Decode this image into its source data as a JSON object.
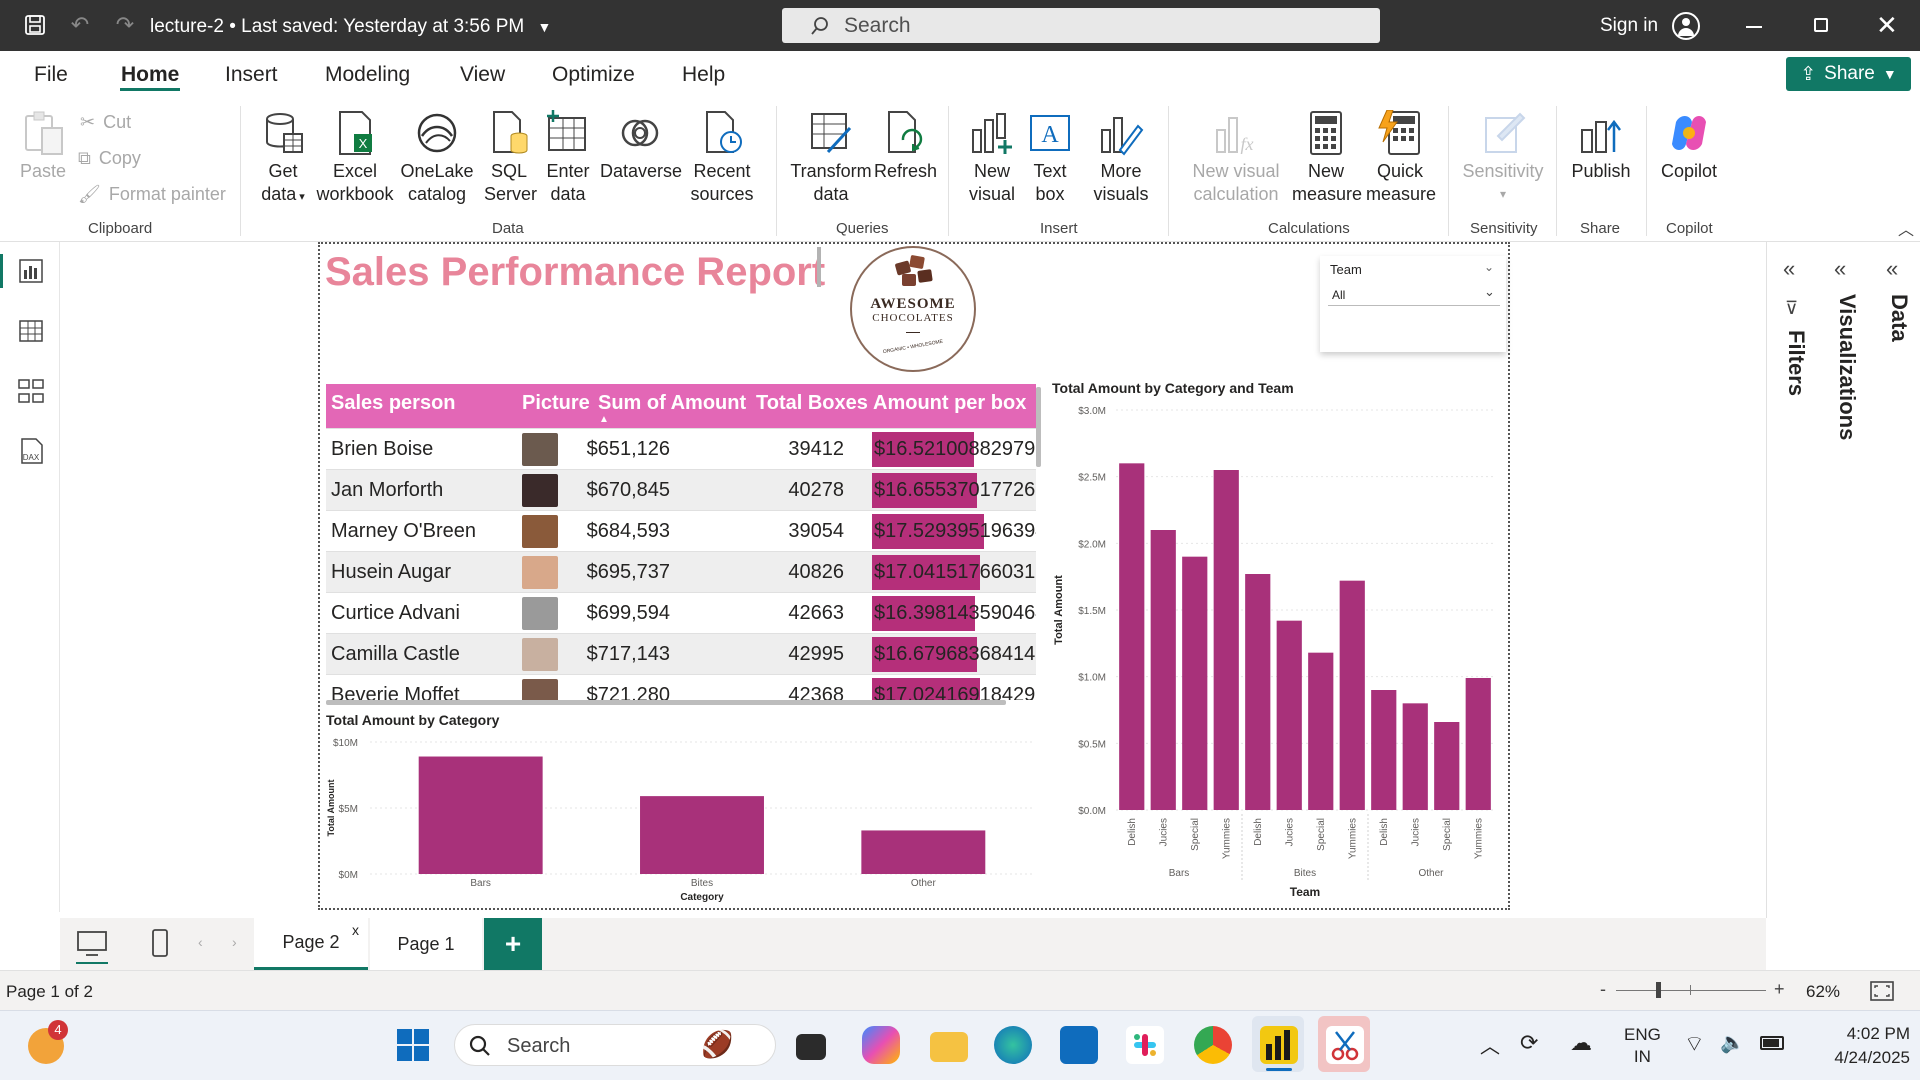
{
  "titlebar": {
    "title": "lecture-2 • Last saved: Yesterday at 3:56 PM",
    "search_placeholder": "Search",
    "signin": "Sign in"
  },
  "menu": {
    "items": [
      "File",
      "Home",
      "Insert",
      "Modeling",
      "View",
      "Optimize",
      "Help"
    ],
    "active": "Home",
    "share": "Share"
  },
  "ribbon": {
    "clipboard": {
      "paste": "Paste",
      "cut": "Cut",
      "copy": "Copy",
      "format_painter": "Format painter",
      "label": "Clipboard"
    },
    "data": {
      "get_data": "Get data",
      "excel": "Excel workbook",
      "onelake": "OneLake catalog",
      "sql": "SQL Server",
      "enter": "Enter data",
      "dataverse": "Dataverse",
      "recent": "Recent sources",
      "label": "Data"
    },
    "queries": {
      "transform": "Transform data",
      "refresh": "Refresh",
      "label": "Queries"
    },
    "insert": {
      "new_visual": "New visual",
      "text_box": "Text box",
      "more_visuals": "More visuals",
      "label": "Insert"
    },
    "calculations": {
      "new_visual_calc": "New visual calculation",
      "new_measure": "New measure",
      "quick_measure": "Quick measure",
      "label": "Calculations"
    },
    "sensitivity": {
      "btn": "Sensitivity",
      "label": "Sensitivity"
    },
    "share": {
      "publish": "Publish",
      "label": "Share"
    },
    "copilot": {
      "btn": "Copilot",
      "label": "Copilot"
    }
  },
  "report": {
    "title": "Sales Performance Report",
    "logo_text_1": "AWESOME",
    "logo_text_2": "CHOCOLATES",
    "logo_text_3": "ORGANIC • WHOLESOME",
    "slicer": {
      "label": "Team",
      "value": "All"
    },
    "table": {
      "headers": [
        "Sales person",
        "Picture",
        "Sum of Amount",
        "Total Boxes",
        "Amount per box"
      ],
      "rows": [
        {
          "name": "Brien Boise",
          "amount": "$651,126",
          "boxes": "39412",
          "per_box": "$16.52100882979​8",
          "fill": 0.62
        },
        {
          "name": "Jan Morforth",
          "amount": "$670,845",
          "boxes": "40278",
          "per_box": "$16.65537017726​7",
          "fill": 0.64
        },
        {
          "name": "Marney O'Breen",
          "amount": "$684,593",
          "boxes": "39054",
          "per_box": "$17.52939519639​4",
          "fill": 0.68
        },
        {
          "name": "Husein Augar",
          "amount": "$695,737",
          "boxes": "40826",
          "per_box": "$17.04151766031",
          "fill": 0.66
        },
        {
          "name": "Curtice Advani",
          "amount": "$699,594",
          "boxes": "42663",
          "per_box": "$16.39814359046​4",
          "fill": 0.63
        },
        {
          "name": "Camilla Castle",
          "amount": "$717,143",
          "boxes": "42995",
          "per_box": "$16.67968368414​9",
          "fill": 0.64
        },
        {
          "name": "Beverie Moffet",
          "amount": "$721,280",
          "boxes": "42368",
          "per_box": "$17.02416918429​0",
          "fill": 0.66
        }
      ]
    }
  },
  "chart_data": [
    {
      "type": "bar",
      "title": "Total Amount by Category",
      "xlabel": "Category",
      "ylabel": "Total Amount",
      "categories": [
        "Bars",
        "Bites",
        "Other"
      ],
      "values": [
        8.9,
        5.9,
        3.3
      ],
      "yticks": [
        "$0M",
        "$5M",
        "$10M"
      ],
      "ylim": [
        0,
        10
      ]
    },
    {
      "type": "bar",
      "title": "Total Amount by Category and Team",
      "xlabel": "Team",
      "ylabel": "Total Amount",
      "groups": [
        "Bars",
        "Bites",
        "Other"
      ],
      "categories": [
        "Delish",
        "Jucies",
        "Special",
        "Yummies",
        "Delish",
        "Jucies",
        "Special",
        "Yummies",
        "Delish",
        "Jucies",
        "Special",
        "Yummies"
      ],
      "values": [
        2.6,
        2.1,
        1.9,
        2.55,
        1.77,
        1.42,
        1.18,
        1.72,
        0.9,
        0.8,
        0.66,
        0.99
      ],
      "yticks": [
        "$0.0M",
        "$0.5M",
        "$1.0M",
        "$1.5M",
        "$2.0M",
        "$2.5M",
        "$3.0M"
      ],
      "ylim": [
        0,
        3
      ]
    }
  ],
  "pages": {
    "tabs": [
      "Page 2",
      "Page 1"
    ],
    "active": "Page 2",
    "add": "+"
  },
  "rpanes": {
    "filters": "Filters",
    "visualizations": "Visualizations",
    "data": "Data"
  },
  "status": {
    "page_info": "Page 1 of 2",
    "zoom": "62%"
  },
  "taskbar": {
    "search": "Search",
    "lang1": "ENG",
    "lang2": "IN",
    "time": "4:02 PM",
    "date": "4/24/2025",
    "badge": "4"
  },
  "colors": {
    "accent": "#117865",
    "bar": "#a8317a",
    "header": "#e367b6",
    "title": "#e8859a"
  }
}
